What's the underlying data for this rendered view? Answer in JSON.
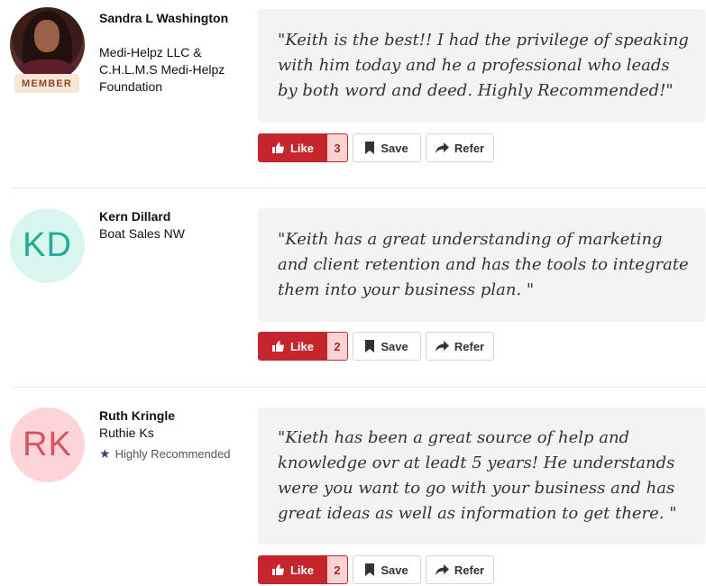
{
  "reviews": [
    {
      "name": "Sandra L Washington",
      "company": "Medi-Helpz LLC & C.H.L.M.S Medi-Helpz Foundation",
      "member_badge": "MEMBER",
      "avatar_type": "photo",
      "quote": "\"Keith is the best!! I had the privilege of speaking with him today and he a professional who leads by both word and deed. Highly Recommended!\"",
      "like_label": "Like",
      "like_count": "3",
      "save_label": "Save",
      "refer_label": "Refer"
    },
    {
      "name": "Kern Dillard",
      "company": "Boat Sales NW",
      "avatar_type": "initials",
      "initials": "KD",
      "avatar_bg": "#d9f5ef",
      "avatar_fg": "#1eae91",
      "quote": "\"Keith has a great understanding of marketing and client retention and has the tools to integrate them into your business plan. \"",
      "like_label": "Like",
      "like_count": "2",
      "save_label": "Save",
      "refer_label": "Refer"
    },
    {
      "name": "Ruth Kringle",
      "company": "Ruthie Ks",
      "status": "Highly Recommended",
      "avatar_type": "initials",
      "initials": "RK",
      "avatar_bg": "#fdd4d8",
      "avatar_fg": "#d8525f",
      "quote": "\"Kieth has been a great source of help and knowledge ovr at leadt 5 years! He understands were you want to go with your business and has great ideas as well as information to get there. \"",
      "like_label": "Like",
      "like_count": "2",
      "save_label": "Save",
      "refer_label": "Refer"
    }
  ],
  "colors": {
    "like": "#c5252c",
    "like_count_bg": "#f7d3d3",
    "quote_bg": "#f3f3f6",
    "star": "#4b3b78"
  },
  "icons": {
    "like": "thumbs-up-icon",
    "save": "bookmark-icon",
    "refer": "share-arrow-icon",
    "status": "star-icon"
  }
}
